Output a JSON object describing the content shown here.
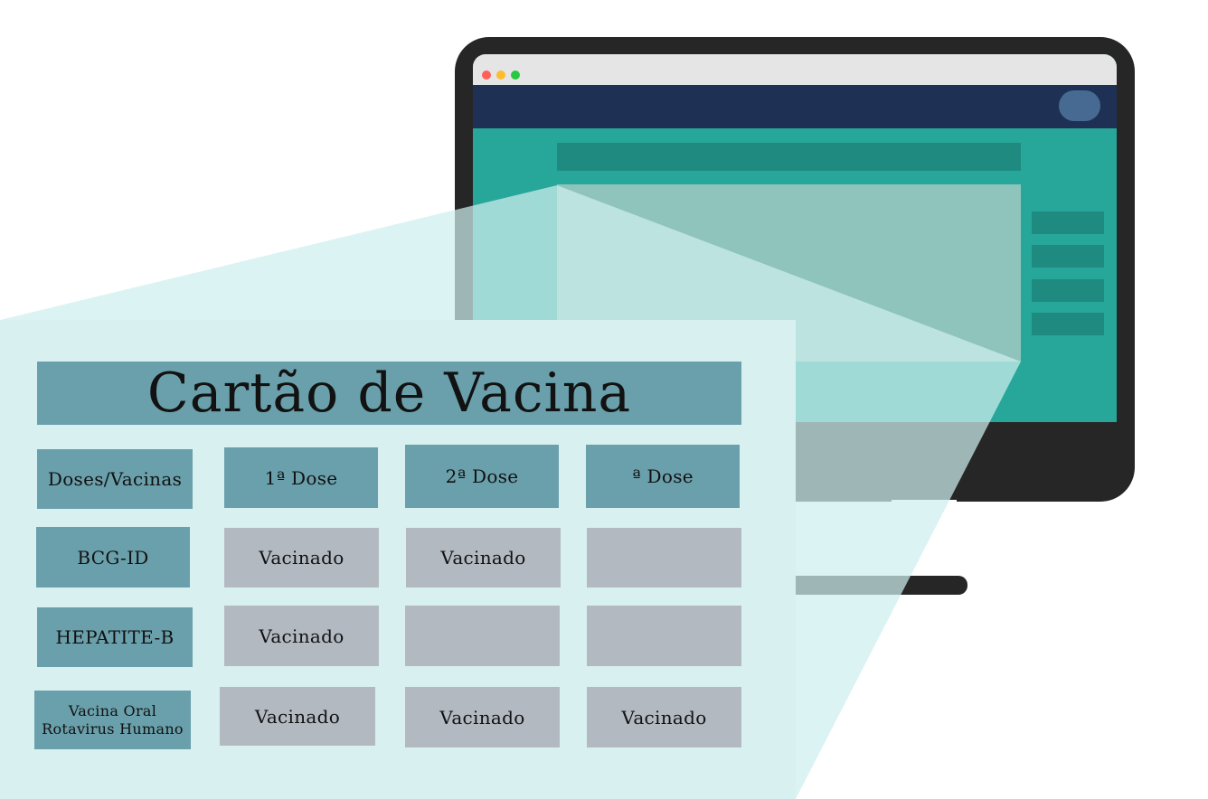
{
  "card": {
    "title": "Cartão de Vacina",
    "header": [
      "Doses/Vacinas",
      "1ª Dose",
      "2ª Dose",
      "ª Dose"
    ],
    "rows": [
      {
        "vaccine": "BCG-ID",
        "doses": [
          "Vacinado",
          "Vacinado",
          ""
        ]
      },
      {
        "vaccine": "HEPATITE-B",
        "doses": [
          "Vacinado",
          "",
          ""
        ]
      },
      {
        "vaccine": "Vacina Oral Rotavirus Humano",
        "doses": [
          "Vacinado",
          "Vacinado",
          "Vacinado"
        ]
      }
    ]
  },
  "colors": {
    "monitor_frame": "#262626",
    "navbar": "#1e3155",
    "screen_teal": "#27a69a",
    "cell_teal": "#6aa0ab",
    "cell_gray": "#b3b9c1",
    "panel": "#d8f0f0"
  },
  "icons": [
    "close-window-dot",
    "minimize-window-dot",
    "maximize-window-dot"
  ]
}
